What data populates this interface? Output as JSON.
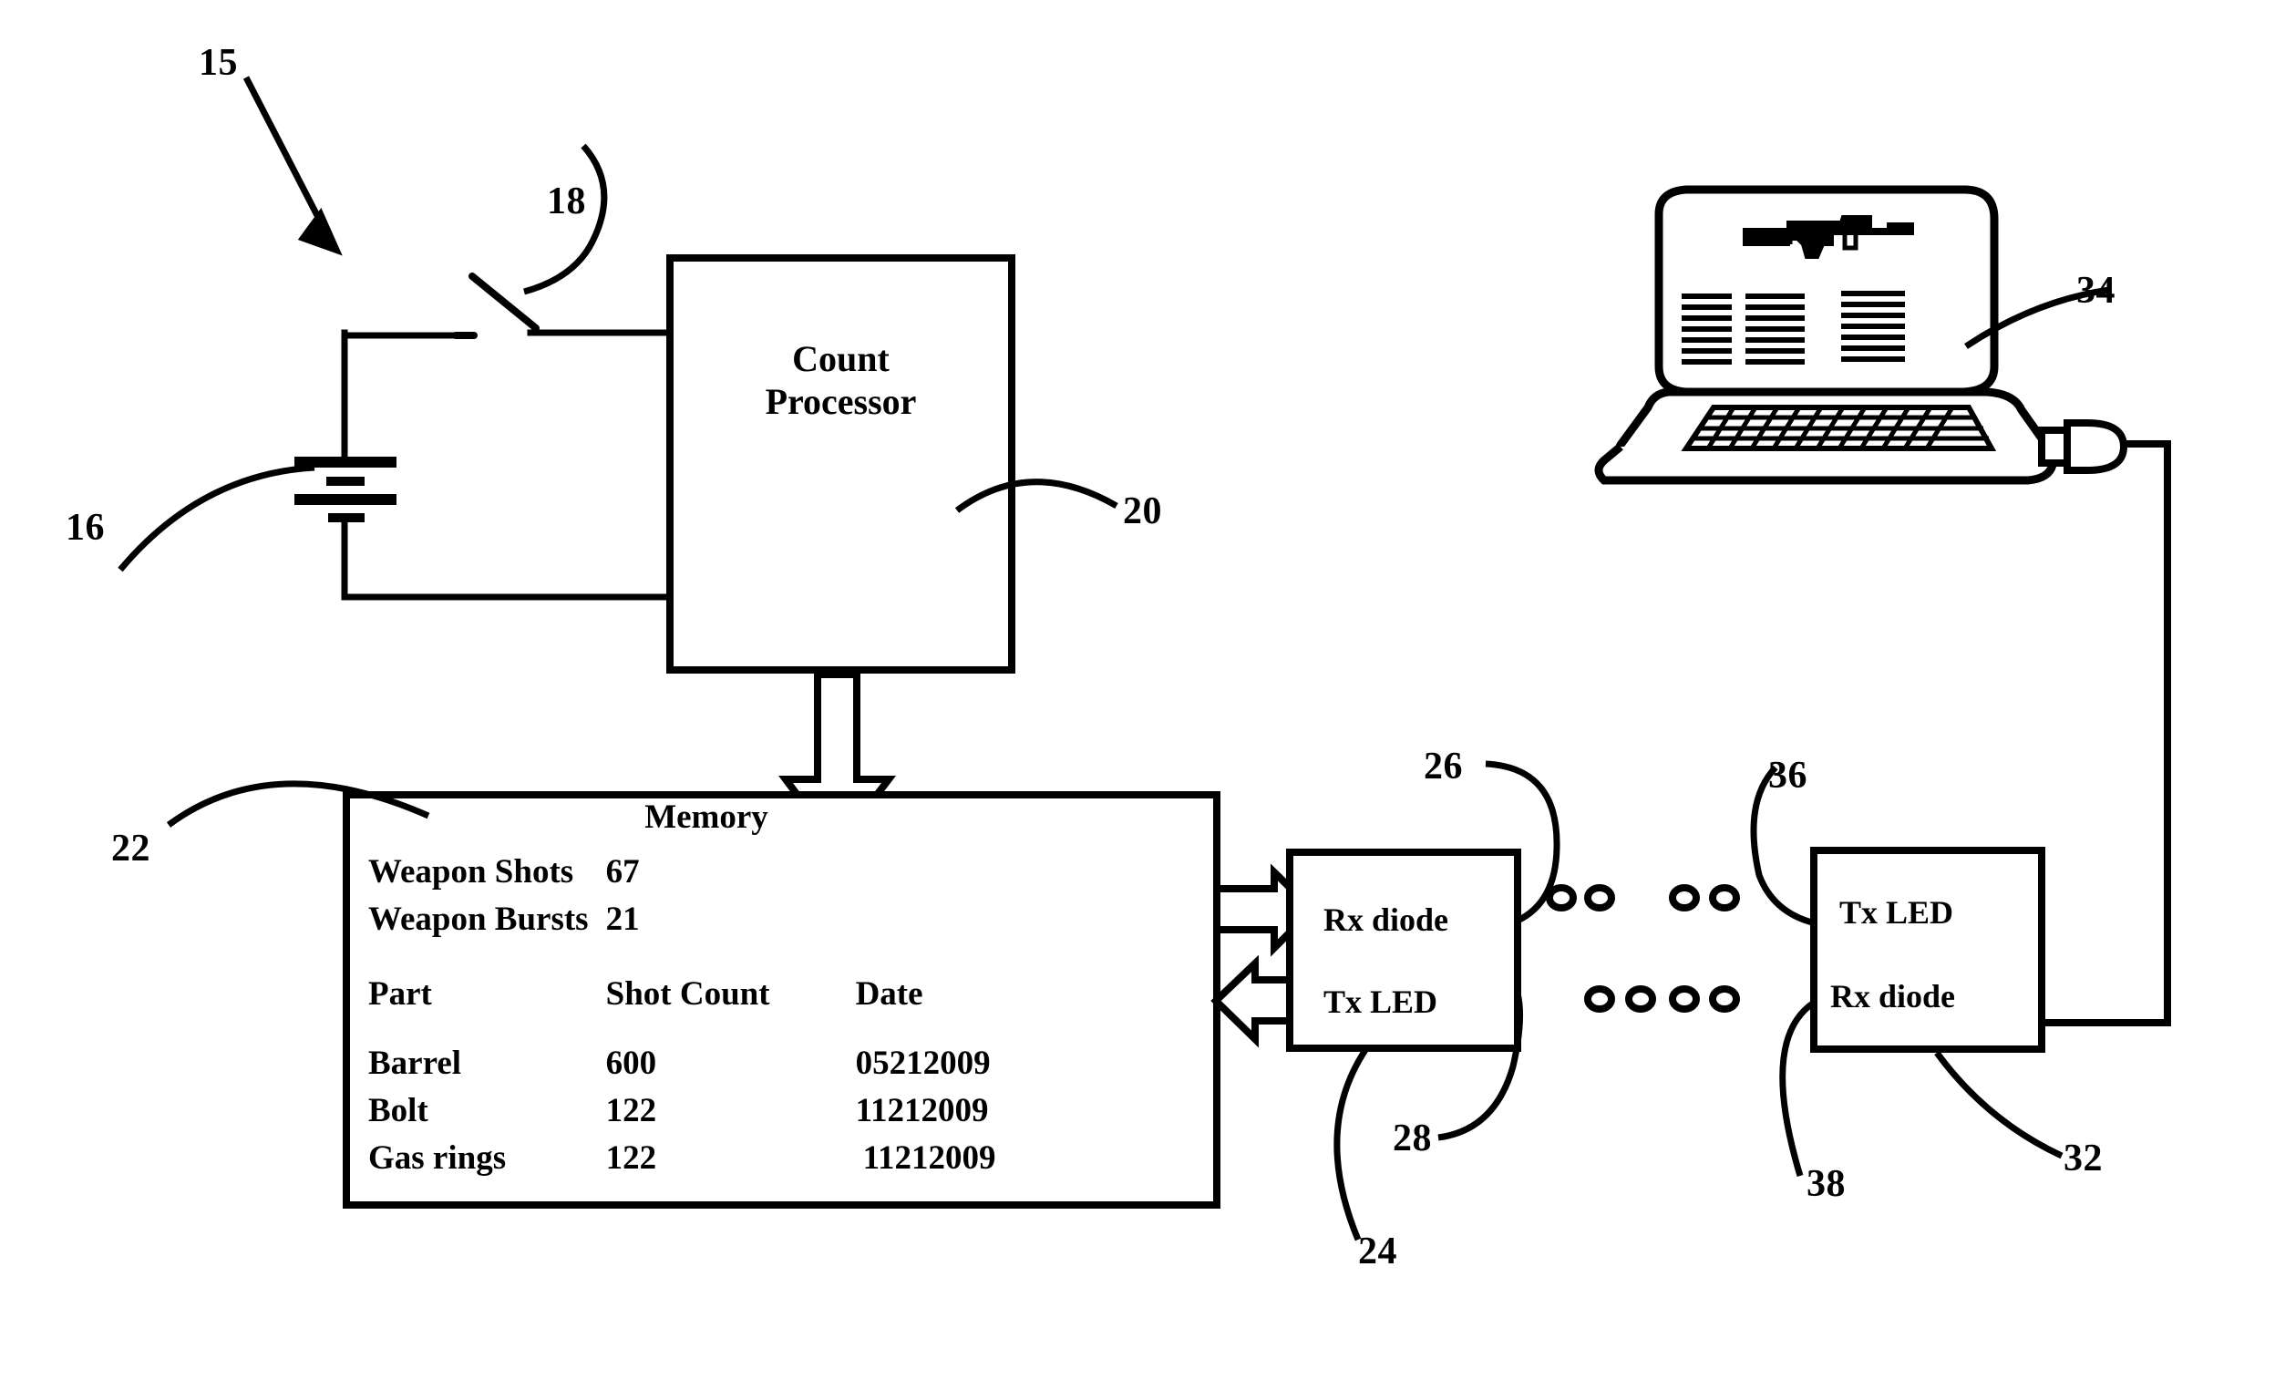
{
  "figure": {
    "type": "patent-block-diagram",
    "background_color": "#ffffff",
    "line_color": "#000000"
  },
  "blocks": {
    "count_processor": {
      "label_line1": "Count",
      "label_line2": "Processor"
    },
    "memory": {
      "title": "Memory",
      "summary": [
        {
          "label": "Weapon Shots",
          "value": "67"
        },
        {
          "label": "Weapon Bursts",
          "value": "21"
        }
      ],
      "table": {
        "headers": [
          "Part",
          "Shot Count",
          "Date"
        ],
        "rows": [
          [
            "Barrel",
            "600",
            "05212009"
          ],
          [
            "Bolt",
            "122",
            "11212009"
          ],
          [
            "Gas rings",
            "122",
            "11212009"
          ]
        ]
      }
    },
    "weapon_transceiver": {
      "top_label": "Rx diode",
      "bottom_label": "Tx LED"
    },
    "remote_transceiver": {
      "top_label": "Tx LED",
      "bottom_label": "Rx diode"
    }
  },
  "reference_numerals": [
    {
      "id": "15",
      "text": "15"
    },
    {
      "id": "16",
      "text": "16"
    },
    {
      "id": "18",
      "text": "18"
    },
    {
      "id": "20",
      "text": "20"
    },
    {
      "id": "22",
      "text": "22"
    },
    {
      "id": "24",
      "text": "24"
    },
    {
      "id": "26",
      "text": "26"
    },
    {
      "id": "28",
      "text": "28"
    },
    {
      "id": "32",
      "text": "32"
    },
    {
      "id": "34",
      "text": "34"
    },
    {
      "id": "36",
      "text": "36"
    },
    {
      "id": "38",
      "text": "38"
    }
  ],
  "icons": {
    "battery": "battery-symbol",
    "switch": "open-switch-symbol",
    "laptop": "laptop-computer",
    "plug": "plug-connector",
    "ir_link_top": "infrared-beam-dots",
    "ir_link_bottom": "infrared-beam-dots"
  }
}
